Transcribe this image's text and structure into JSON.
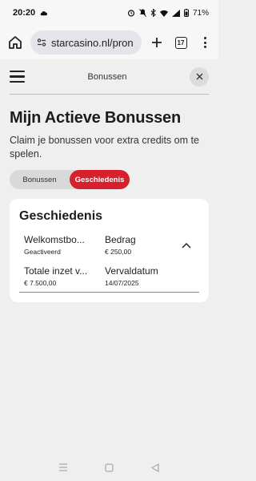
{
  "status_bar": {
    "time": "20:20",
    "battery": "71%"
  },
  "browser": {
    "url": "starcasino.nl/pron",
    "tab_count": "17"
  },
  "header": {
    "title": "Bonussen"
  },
  "page": {
    "title": "Mijn Actieve Bonussen",
    "subtitle": "Claim je bonussen voor extra credits om te spelen."
  },
  "tabs": [
    {
      "label": "Bonussen",
      "active": false
    },
    {
      "label": "Geschiedenis",
      "active": true
    }
  ],
  "history": {
    "title": "Geschiedenis",
    "items": [
      {
        "name_label": "Welkomstbo...",
        "status": "Geactiveerd",
        "amount_label": "Bedrag",
        "amount": "€ 250,00",
        "total_bet_label": "Totale inzet v...",
        "total_bet": "€ 7.500,00",
        "expiry_label": "Vervaldatum",
        "expiry": "14/07/2025"
      }
    ]
  },
  "colors": {
    "accent": "#d8202c",
    "background": "#efefef",
    "card": "#ffffff"
  }
}
